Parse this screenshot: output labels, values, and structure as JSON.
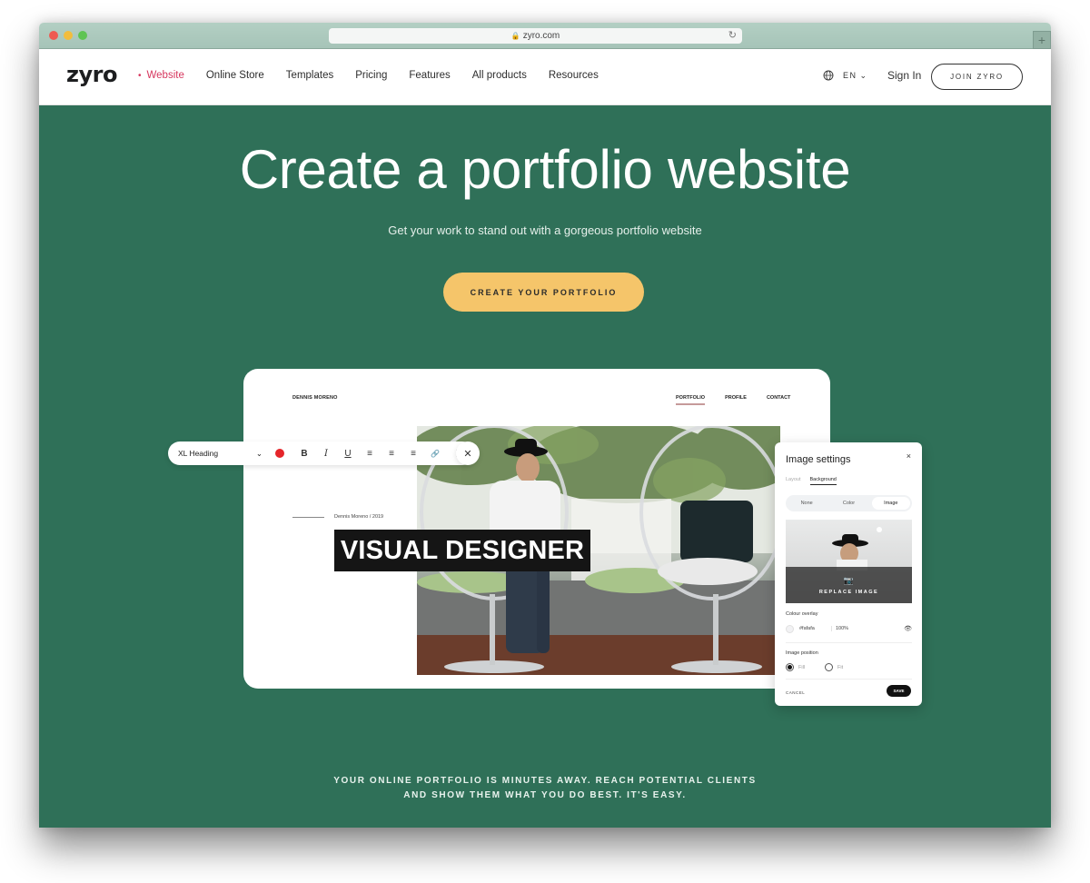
{
  "browser": {
    "url": "zyro.com",
    "lock_icon": "lock-icon",
    "reload_icon": "reload-icon",
    "new_tab_label": "+"
  },
  "nav": {
    "logo": "zyro",
    "items": [
      {
        "label": "Website",
        "active": true
      },
      {
        "label": "Online Store"
      },
      {
        "label": "Templates"
      },
      {
        "label": "Pricing"
      },
      {
        "label": "Features"
      },
      {
        "label": "All products"
      },
      {
        "label": "Resources"
      }
    ],
    "language": "EN",
    "sign_in": "Sign In",
    "join": "JOIN ZYRO"
  },
  "hero": {
    "title": "Create a portfolio website",
    "subtitle": "Get your work to stand out with a gorgeous portfolio website",
    "cta": "CREATE YOUR PORTFOLIO",
    "footer_line1": "YOUR ONLINE PORTFOLIO IS MINUTES AWAY. REACH POTENTIAL CLIENTS",
    "footer_line2": "AND SHOW THEM WHAT YOU DO BEST. IT'S EASY.",
    "background_color": "#2f7058",
    "cta_color": "#f5c56a"
  },
  "mockup": {
    "brand": "DENNIS MORENO",
    "nav": [
      "PORTFOLIO",
      "PROFILE",
      "CONTACT"
    ],
    "meta": "Dennis Moreno / 2019",
    "heading": "VISUAL DESIGNER"
  },
  "toolbar": {
    "style": "XL Heading",
    "color": "#e5252a",
    "bold": "B",
    "italic": "I",
    "underline": "U",
    "align_left": "≡",
    "align_center": "≡",
    "align_right": "≡",
    "link": "🔗",
    "more": "⋮",
    "close": "✕"
  },
  "image_settings": {
    "title": "Image settings",
    "close": "×",
    "tabs": [
      "Layout",
      "Background"
    ],
    "active_tab": "Background",
    "segments": [
      "None",
      "Color",
      "Image"
    ],
    "active_segment": "Image",
    "replace_label": "REPLACE IMAGE",
    "overlay_label": "Colour overlay",
    "overlay_hex": "#fafafa",
    "overlay_opacity": "100%",
    "position_label": "Image position",
    "position_options": [
      "Fill",
      "Fit"
    ],
    "position_selected": "Fill",
    "cancel": "CANCEL",
    "save": "SAVE"
  }
}
